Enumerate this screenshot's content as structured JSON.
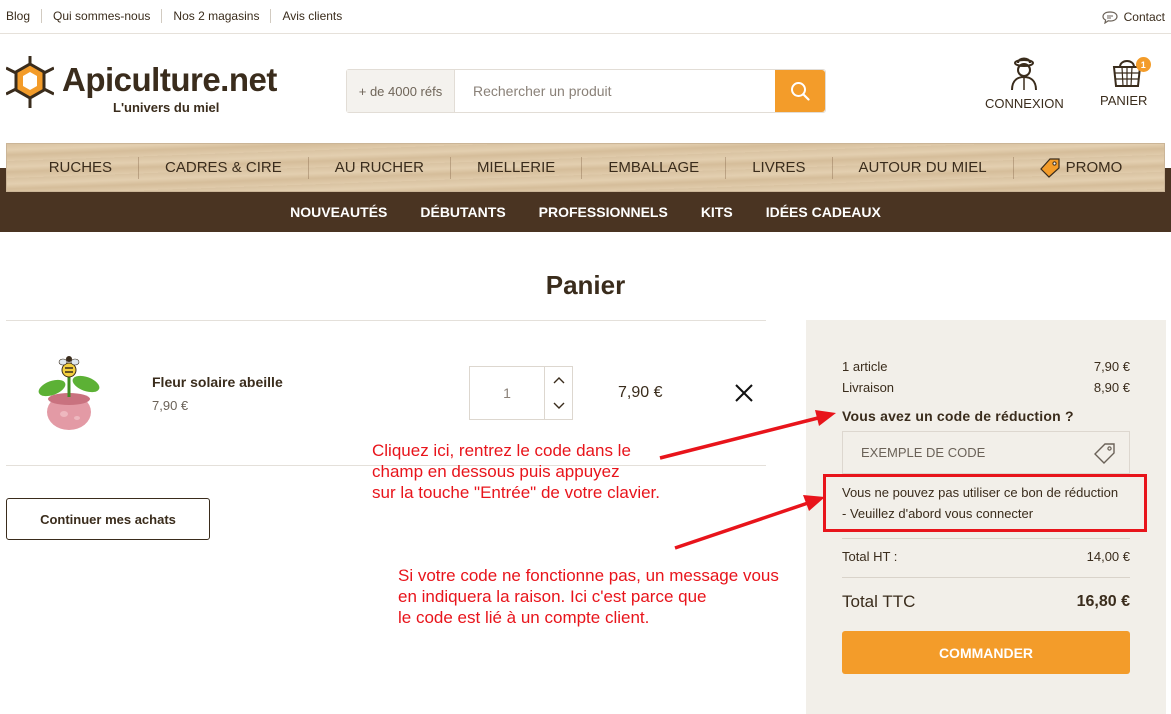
{
  "topbar": {
    "links": [
      "Blog",
      "Qui sommes-nous",
      "Nos 2 magasins",
      "Avis clients"
    ],
    "contact": "Contact"
  },
  "header": {
    "logo_name": "Apiculture.net",
    "logo_tagline": "L'univers du miel",
    "search_refs": "+ de 4000 réfs",
    "search_placeholder": "Rechercher un produit",
    "login_label": "CONNEXION",
    "cart_label": "PANIER",
    "cart_count": "1"
  },
  "nav": {
    "main": [
      "RUCHES",
      "CADRES & CIRE",
      "AU RUCHER",
      "MIELLERIE",
      "EMBALLAGE",
      "LIVRES",
      "AUTOUR DU MIEL",
      "PROMO"
    ],
    "sub": [
      "NOUVEAUTÉS",
      "DÉBUTANTS",
      "PROFESSIONNELS",
      "KITS",
      "IDÉES CADEAUX"
    ]
  },
  "cart": {
    "title": "Panier",
    "item": {
      "name": "Fleur solaire abeille",
      "unit_price": "7,90 €",
      "quantity": "1",
      "line_total": "7,90 €"
    },
    "continue_label": "Continuer mes achats"
  },
  "summary": {
    "articles_label": "1 article",
    "articles_value": "7,90 €",
    "shipping_label": "Livraison",
    "shipping_value": "8,90 €",
    "discount_question": "Vous avez un code de réduction ?",
    "code_placeholder": "EXEMPLE DE CODE",
    "error_line1": "Vous ne pouvez pas utiliser ce bon de réduction",
    "error_line2": "- Veuillez d'abord vous connecter",
    "total_ht_label": "Total HT :",
    "total_ht_value": "14,00 €",
    "total_ttc_label": "Total TTC",
    "total_ttc_value": "16,80 €",
    "order_label": "COMMANDER"
  },
  "annotations": {
    "note1": [
      "Cliquez ici, rentrez le code dans le",
      "champ en dessous puis appuyez",
      "sur la touche \"Entrée\" de votre clavier."
    ],
    "note2": [
      "Si votre code ne fonctionne pas, un message vous",
      "en indiquera la raison. Ici c'est parce que",
      "le code est lié à un compte client."
    ]
  },
  "colors": {
    "accent": "#f39c2a",
    "brown": "#4a3422",
    "text": "#3a2c1c",
    "annotation_red": "#e8141b",
    "panel": "#f2efe9"
  }
}
